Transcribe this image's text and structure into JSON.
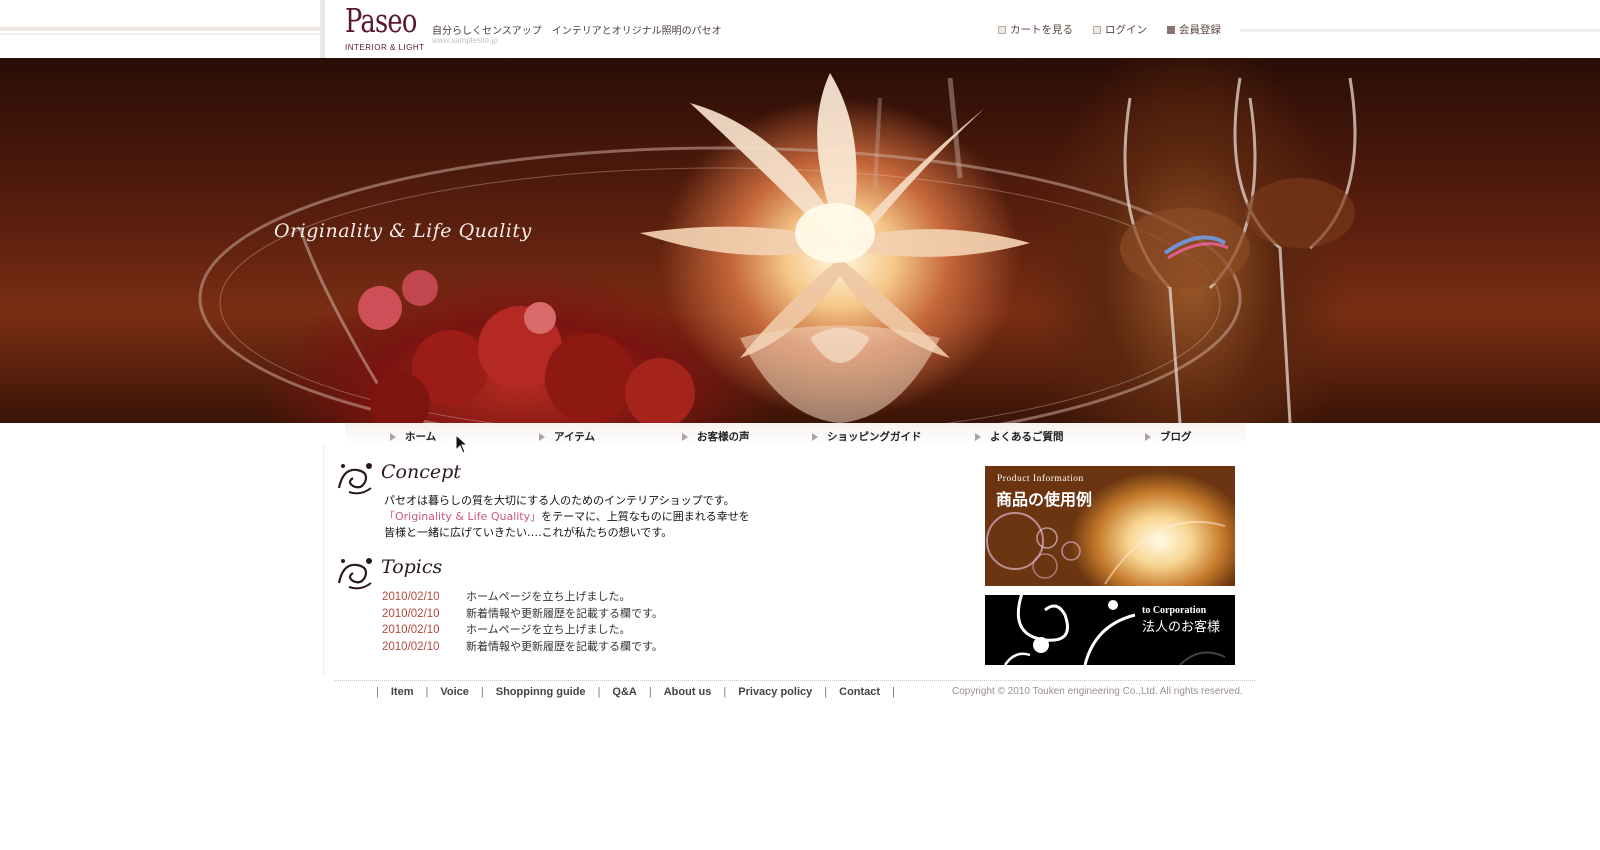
{
  "header": {
    "logo_main": "Paseo",
    "logo_sub": "INTERIOR & LIGHT",
    "tagline": "自分らしくセンスアップ　インテリアとオリジナル照明のパセオ",
    "site_url": "www.samplesite.jp",
    "links": [
      {
        "label": "カートを見る",
        "icon": "checkbox-icon"
      },
      {
        "label": "ログイン",
        "icon": "checkbox-icon"
      },
      {
        "label": "会員登録",
        "icon": "checkbox-icon"
      }
    ]
  },
  "hero": {
    "tagline": "Originality & Life Quality"
  },
  "nav": {
    "items": [
      "ホーム",
      "アイテム",
      "お客様の声",
      "ショッピングガイド",
      "よくあるご質問",
      "ブログ"
    ]
  },
  "concept": {
    "title": "Concept",
    "line1": "パセオは暮らしの質を大切にする人のためのインテリアショップです。",
    "line2_highlight": "「Originality & Life Quality」",
    "line2_rest": "をテーマに、上質なものに囲まれる幸せを",
    "line3": "皆様と一緒に広げていきたい‥‥これが私たちの想いです。"
  },
  "topics": {
    "title": "Topics",
    "items": [
      {
        "date": "2010/02/10",
        "text": "ホームページを立ち上げました。"
      },
      {
        "date": "2010/02/10",
        "text": "新着情報や更新履歴を記載する欄です。"
      },
      {
        "date": "2010/02/10",
        "text": "ホームページを立ち上げました。"
      },
      {
        "date": "2010/02/10",
        "text": "新着情報や更新履歴を記載する欄です。"
      }
    ]
  },
  "banners": {
    "product": {
      "en": "Product Information",
      "jp": "商品の使用例"
    },
    "corporate": {
      "en": "to Corporation",
      "jp": "法人のお客様"
    }
  },
  "footer": {
    "links": [
      "Item",
      "Voice",
      "Shoppinng guide",
      "Q&A",
      "About us",
      "Privacy policy",
      "Contact"
    ],
    "copyright": "Copyright © 2010 Touken engineering Co.,Ltd. All rights reserved."
  },
  "colors": {
    "brand": "#5a1a2a",
    "date": "#b44a3e",
    "highlight": "#c85a78"
  }
}
